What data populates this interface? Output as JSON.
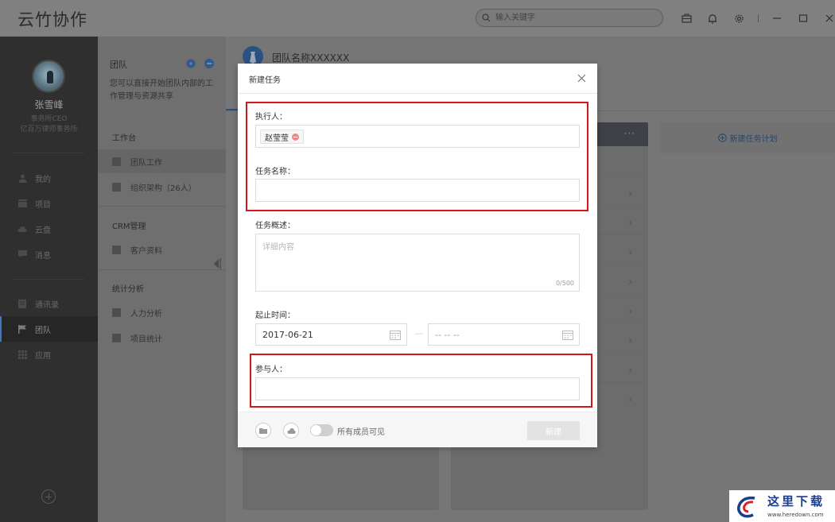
{
  "app": {
    "title": "云竹协作",
    "search_placeholder": "输入关键字"
  },
  "topbar_icons": [
    "briefcase-icon",
    "bell-icon",
    "settings-icon",
    "minimize-icon",
    "maximize-icon",
    "close-icon"
  ],
  "user": {
    "name": "张雪峰",
    "role": "事务所CEO",
    "org": "亿百万律师事务所"
  },
  "nav": {
    "items": [
      {
        "label": "我的",
        "icon": "user-icon"
      },
      {
        "label": "项目",
        "icon": "project-icon"
      },
      {
        "label": "云盘",
        "icon": "cloud-icon"
      },
      {
        "label": "消息",
        "icon": "message-icon"
      },
      {
        "label": "通讯录",
        "icon": "contacts-icon"
      },
      {
        "label": "团队",
        "icon": "flag-icon",
        "active": true
      },
      {
        "label": "应用",
        "icon": "apps-grid-icon"
      }
    ]
  },
  "team_panel": {
    "title": "团队",
    "description": "您可以直接开始团队内部的工作管理与资源共享",
    "sections": [
      {
        "title": "工作台",
        "items": [
          "团队工作",
          "组织架构（26人）"
        ]
      },
      {
        "title": "CRM管理",
        "items": [
          "客户资料"
        ]
      },
      {
        "title": "统计分析",
        "items": [
          "人力分析",
          "项目统计"
        ]
      }
    ]
  },
  "main": {
    "team_name": "团队名称XXXXXX",
    "plan_button": "新建任务计划",
    "more_label": "···"
  },
  "modal": {
    "title": "新建任务",
    "executor_label": "执行人：",
    "executor_tag": "赵莹莹",
    "task_name_label": "任务名称：",
    "task_name_value": "",
    "summary_label": "任务概述：",
    "summary_placeholder": "详细内容",
    "summary_counter": "0/500",
    "date_label": "起止时间：",
    "start_date": "2017-06-21",
    "end_date_placeholder": "-- -- --",
    "date_separator": "—",
    "participants_label": "参与人：",
    "visible_toggle_label": "所有成员可见",
    "visible_toggle_on": false,
    "create_button": "新建"
  },
  "watermark": {
    "text": "这里下载",
    "url": "www.heredown.com"
  },
  "colors": {
    "highlight_red": "#d01818",
    "accent_blue": "#3d78c0"
  }
}
